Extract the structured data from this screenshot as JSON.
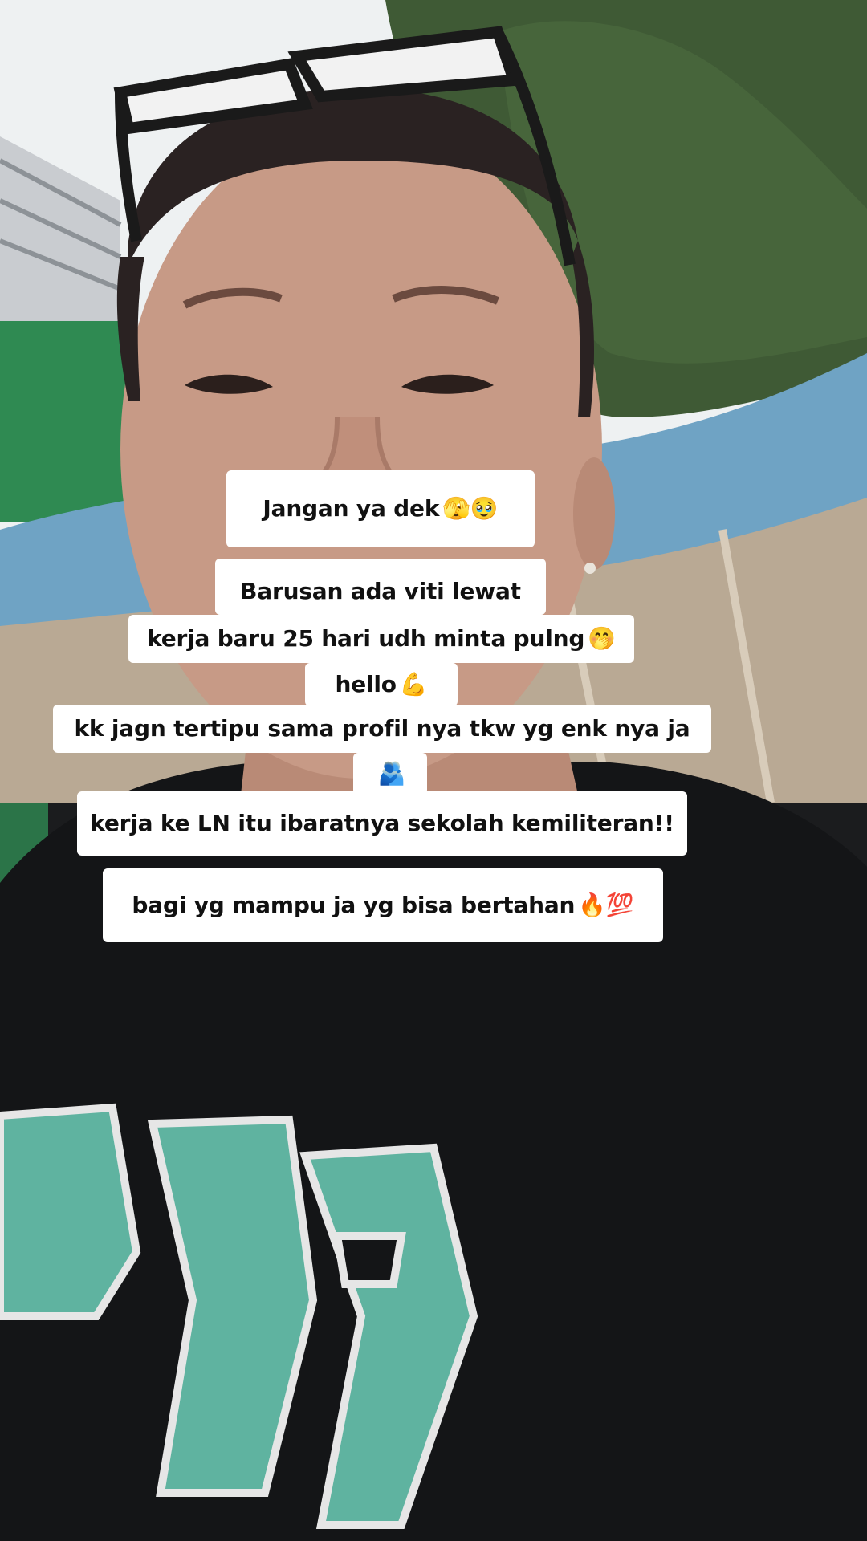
{
  "captions": {
    "line1": {
      "text": "Jangan ya dek",
      "emoji": "🫣🥹"
    },
    "line2": {
      "text": "Barusan ada viti lewat"
    },
    "line3": {
      "text": "kerja baru 25 hari udh minta pulng",
      "emoji": "🤭"
    },
    "line4": {
      "text": "hello",
      "emoji": "💪"
    },
    "line5": {
      "text": "kk jagn tertipu sama profil nya tkw yg enk nya ja"
    },
    "line6": {
      "emoji": "🫂"
    },
    "line7": {
      "text": "kerja ke LN itu ibaratnya sekolah kemiliteran!!"
    },
    "line8": {
      "text": "bagi yg mampu ja yg bisa bertahan",
      "emoji": "🔥💯"
    }
  },
  "colors": {
    "caption_bg": "#ffffff",
    "caption_text": "#111111",
    "sky": "#eef1f2",
    "tree": "#3f5a35",
    "roof_blue": "#6fa3c4",
    "roof_green": "#2f8a52",
    "shirt": "#141517",
    "shirt_print": "#5fb3a0",
    "skin": "#c79a86",
    "hair": "#2a2222",
    "glasses": "#1a1a1a"
  }
}
